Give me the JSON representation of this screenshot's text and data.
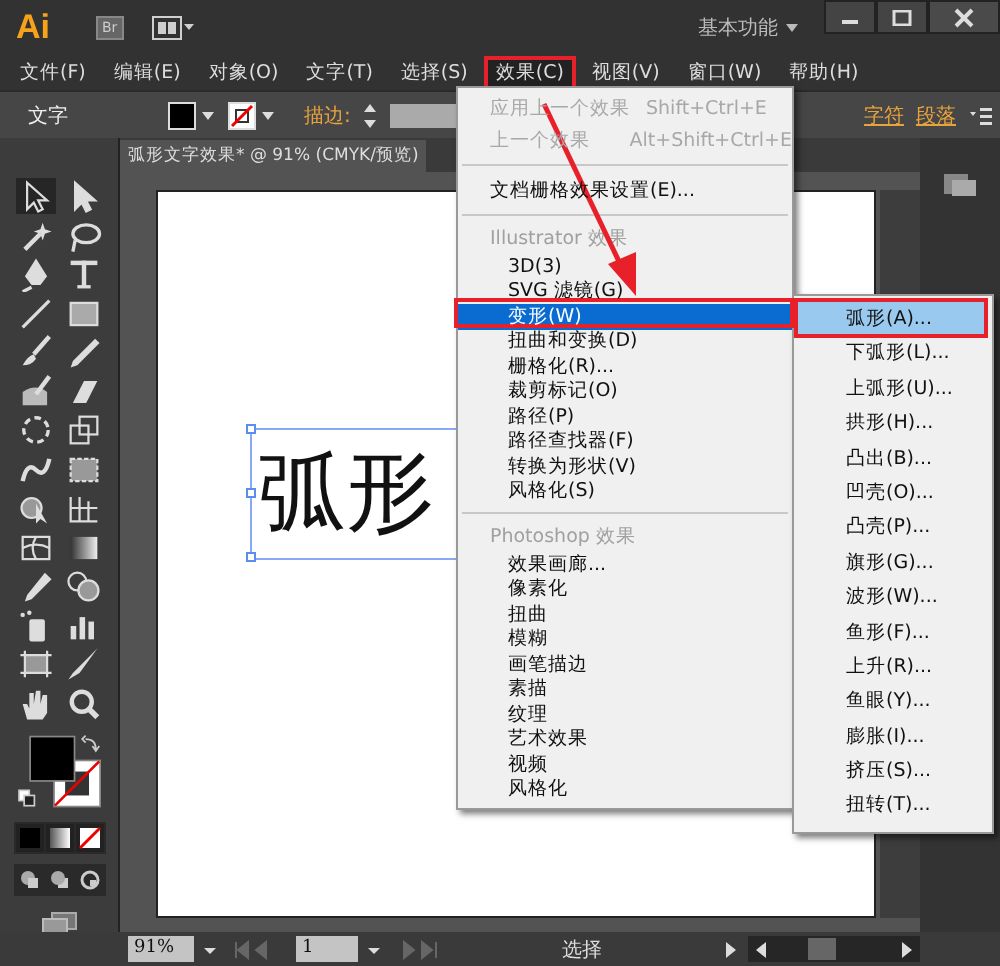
{
  "title_bar": {
    "logo": "Ai",
    "bridge": "Br",
    "workspace": "基本功能"
  },
  "menu_bar": [
    {
      "label": "文件(F)",
      "selected": false
    },
    {
      "label": "编辑(E)",
      "selected": false
    },
    {
      "label": "对象(O)",
      "selected": false
    },
    {
      "label": "文字(T)",
      "selected": false
    },
    {
      "label": "选择(S)",
      "selected": false
    },
    {
      "label": "效果(C)",
      "selected": true
    },
    {
      "label": "视图(V)",
      "selected": false
    },
    {
      "label": "窗口(W)",
      "selected": false
    },
    {
      "label": "帮助(H)",
      "selected": false
    }
  ],
  "control_bar": {
    "label": "文字",
    "stroke_label": "描边:",
    "links": [
      "字符",
      "段落"
    ]
  },
  "document_tab": {
    "title": "弧形文字效果* @ 91% (CMYK/预览)"
  },
  "canvas": {
    "text": "弧形"
  },
  "effect_menu": {
    "items": [
      {
        "kind": "item",
        "label": "应用上一个效果",
        "shortcut": "Shift+Ctrl+E",
        "disabled": true,
        "selected": false
      },
      {
        "kind": "item",
        "label": "上一个效果",
        "shortcut": "Alt+Shift+Ctrl+E",
        "disabled": true,
        "selected": false
      },
      {
        "kind": "separator"
      },
      {
        "kind": "item",
        "label": "文档栅格效果设置(E)...",
        "disabled": false,
        "selected": false
      },
      {
        "kind": "separator"
      },
      {
        "kind": "header",
        "label": "Illustrator 效果"
      },
      {
        "kind": "subitem",
        "label": "3D(3)",
        "disabled": false,
        "selected": false
      },
      {
        "kind": "subitem",
        "label": "SVG 滤镜(G)",
        "disabled": false,
        "selected": false
      },
      {
        "kind": "subitem",
        "label": "变形(W)",
        "disabled": false,
        "selected": true
      },
      {
        "kind": "subitem",
        "label": "扭曲和变换(D)",
        "disabled": false,
        "selected": false
      },
      {
        "kind": "subitem",
        "label": "栅格化(R)...",
        "disabled": false,
        "selected": false
      },
      {
        "kind": "subitem",
        "label": "裁剪标记(O)",
        "disabled": false,
        "selected": false
      },
      {
        "kind": "subitem",
        "label": "路径(P)",
        "disabled": false,
        "selected": false
      },
      {
        "kind": "subitem",
        "label": "路径查找器(F)",
        "disabled": false,
        "selected": false
      },
      {
        "kind": "subitem",
        "label": "转换为形状(V)",
        "disabled": false,
        "selected": false
      },
      {
        "kind": "subitem",
        "label": "风格化(S)",
        "disabled": false,
        "selected": false
      },
      {
        "kind": "separator"
      },
      {
        "kind": "header",
        "label": "Photoshop 效果"
      },
      {
        "kind": "subitem",
        "label": "效果画廊...",
        "disabled": false,
        "selected": false
      },
      {
        "kind": "subitem",
        "label": "像素化",
        "disabled": false,
        "selected": false
      },
      {
        "kind": "subitem",
        "label": "扭曲",
        "disabled": false,
        "selected": false
      },
      {
        "kind": "subitem",
        "label": "模糊",
        "disabled": false,
        "selected": false
      },
      {
        "kind": "subitem",
        "label": "画笔描边",
        "disabled": false,
        "selected": false
      },
      {
        "kind": "subitem",
        "label": "素描",
        "disabled": false,
        "selected": false
      },
      {
        "kind": "subitem",
        "label": "纹理",
        "disabled": false,
        "selected": false
      },
      {
        "kind": "subitem",
        "label": "艺术效果",
        "disabled": false,
        "selected": false
      },
      {
        "kind": "subitem",
        "label": "视频",
        "disabled": false,
        "selected": false
      },
      {
        "kind": "subitem",
        "label": "风格化",
        "disabled": false,
        "selected": false
      }
    ]
  },
  "warp_submenu": {
    "items": [
      {
        "label": "弧形(A)...",
        "selected": true
      },
      {
        "label": "下弧形(L)...",
        "selected": false
      },
      {
        "label": "上弧形(U)...",
        "selected": false
      },
      {
        "label": "拱形(H)...",
        "selected": false
      },
      {
        "label": "凸出(B)...",
        "selected": false
      },
      {
        "label": "凹壳(O)...",
        "selected": false
      },
      {
        "label": "凸壳(P)...",
        "selected": false
      },
      {
        "label": "旗形(G)...",
        "selected": false
      },
      {
        "label": "波形(W)...",
        "selected": false
      },
      {
        "label": "鱼形(F)...",
        "selected": false
      },
      {
        "label": "上升(R)...",
        "selected": false
      },
      {
        "label": "鱼眼(Y)...",
        "selected": false
      },
      {
        "label": "膨胀(I)...",
        "selected": false
      },
      {
        "label": "挤压(S)...",
        "selected": false
      },
      {
        "label": "扭转(T)...",
        "selected": false
      }
    ]
  },
  "status_bar": {
    "zoom": "91%",
    "page": "1",
    "tool": "选择"
  }
}
